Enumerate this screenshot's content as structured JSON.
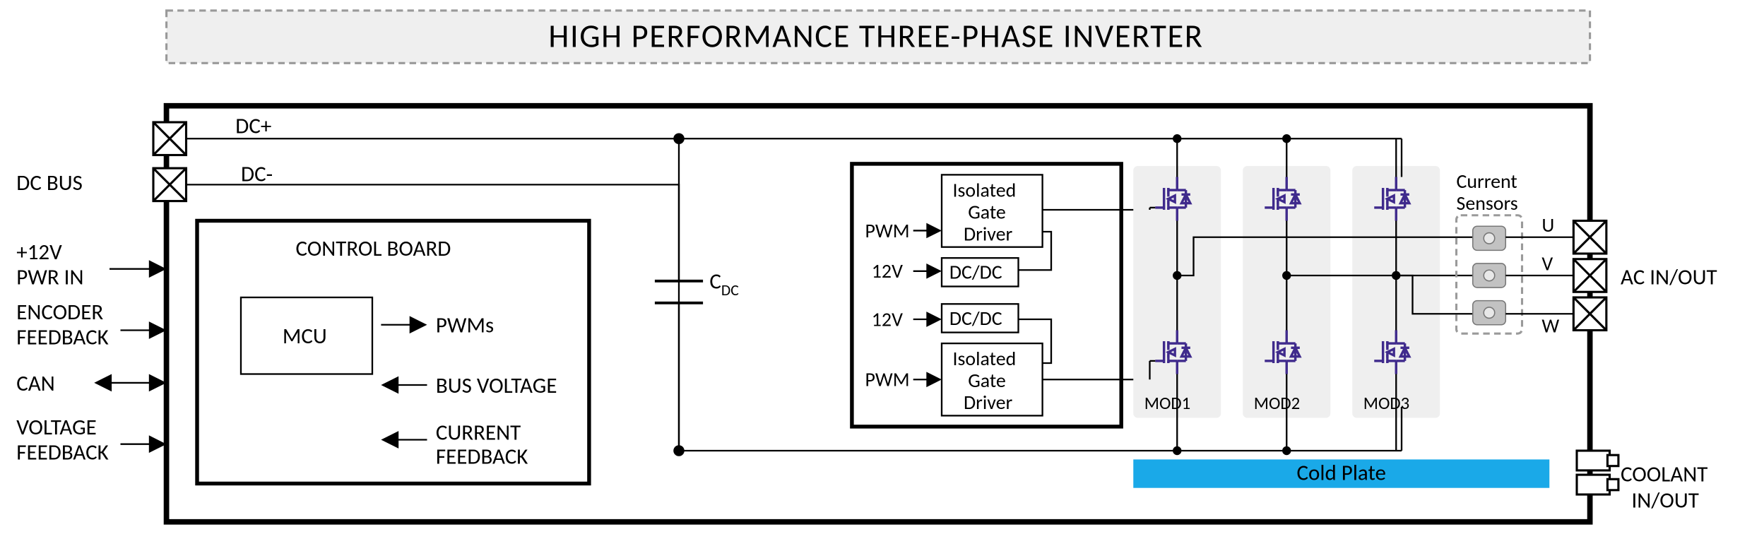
{
  "title": "HIGH PERFORMANCE THREE-PHASE INVERTER",
  "left_io": {
    "dcbus": "DC BUS",
    "pwr12": "+12V",
    "pwr_in": "PWR IN",
    "enc1": "ENCODER",
    "enc2": "FEEDBACK",
    "can": "CAN",
    "vfb1": "VOLTAGE",
    "vfb2": "FEEDBACK"
  },
  "dc": {
    "plus": "DC+",
    "minus": "DC-"
  },
  "control": {
    "board": "CONTROL BOARD",
    "mcu": "MCU",
    "pwms": "PWMs",
    "busv": "BUS VOLTAGE",
    "ifb1": "CURRENT",
    "ifb2": "FEEDBACK"
  },
  "cdc": "C",
  "cdc_sub": "DC",
  "driver": {
    "iso_top": "Isolated",
    "iso_mid": "Gate",
    "iso_bot": "Driver",
    "dcdc": "DC/DC",
    "pwm": "PWM",
    "_12v": "12V"
  },
  "mods": {
    "m1": "MOD1",
    "m2": "MOD2",
    "m3": "MOD3"
  },
  "cs": {
    "title1": "Current",
    "title2": "Sensors"
  },
  "phases": {
    "u": "U",
    "v": "V",
    "w": "W"
  },
  "ac": "AC IN/OUT",
  "coldplate": "Cold Plate",
  "coolant1": "COOLANT",
  "coolant2": "IN/OUT"
}
